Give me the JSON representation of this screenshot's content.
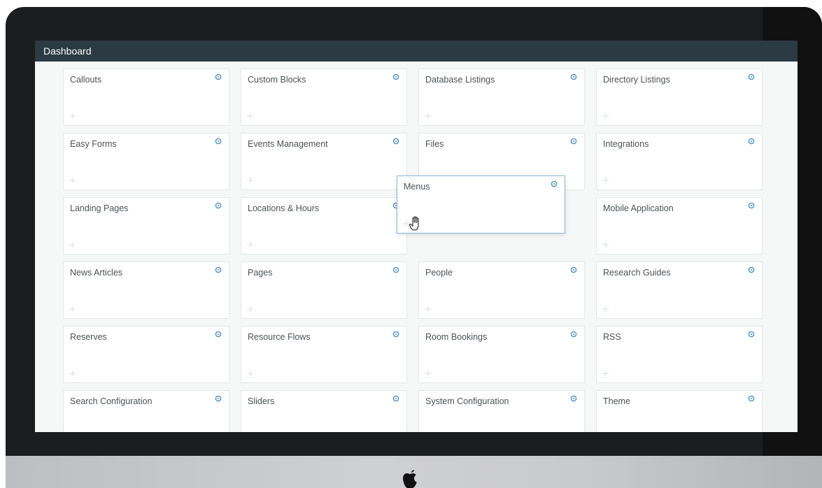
{
  "topbar": {
    "title": "Dashboard"
  },
  "cards": [
    {
      "label": "Callouts"
    },
    {
      "label": "Custom Blocks"
    },
    {
      "label": "Database Listings"
    },
    {
      "label": "Directory Listings"
    },
    {
      "label": "Easy Forms"
    },
    {
      "label": "Events Management"
    },
    {
      "label": "Files"
    },
    {
      "label": "Integrations"
    },
    {
      "label": "Landing Pages"
    },
    {
      "label": "Locations & Hours"
    },
    {
      "label": ""
    },
    {
      "label": "Mobile Application"
    },
    {
      "label": "News Articles"
    },
    {
      "label": "Pages"
    },
    {
      "label": "People"
    },
    {
      "label": "Research Guides"
    },
    {
      "label": "Reserves"
    },
    {
      "label": "Resource Flows"
    },
    {
      "label": "Room Bookings"
    },
    {
      "label": "RSS"
    },
    {
      "label": "Search Configuration"
    },
    {
      "label": "Sliders"
    },
    {
      "label": "System Configuration"
    },
    {
      "label": "Theme"
    }
  ],
  "dragging_card": {
    "label": "Menus"
  },
  "colors": {
    "topbar": "#2b3a43",
    "accent": "#4a90c8",
    "card_border": "#e4e7e9",
    "screen_bg": "#f6f8f8"
  },
  "icons": {
    "card_settings": "gear-icon",
    "card_handle": "move-icon",
    "cursor": "grab-cursor-icon",
    "logo": "apple-logo"
  }
}
